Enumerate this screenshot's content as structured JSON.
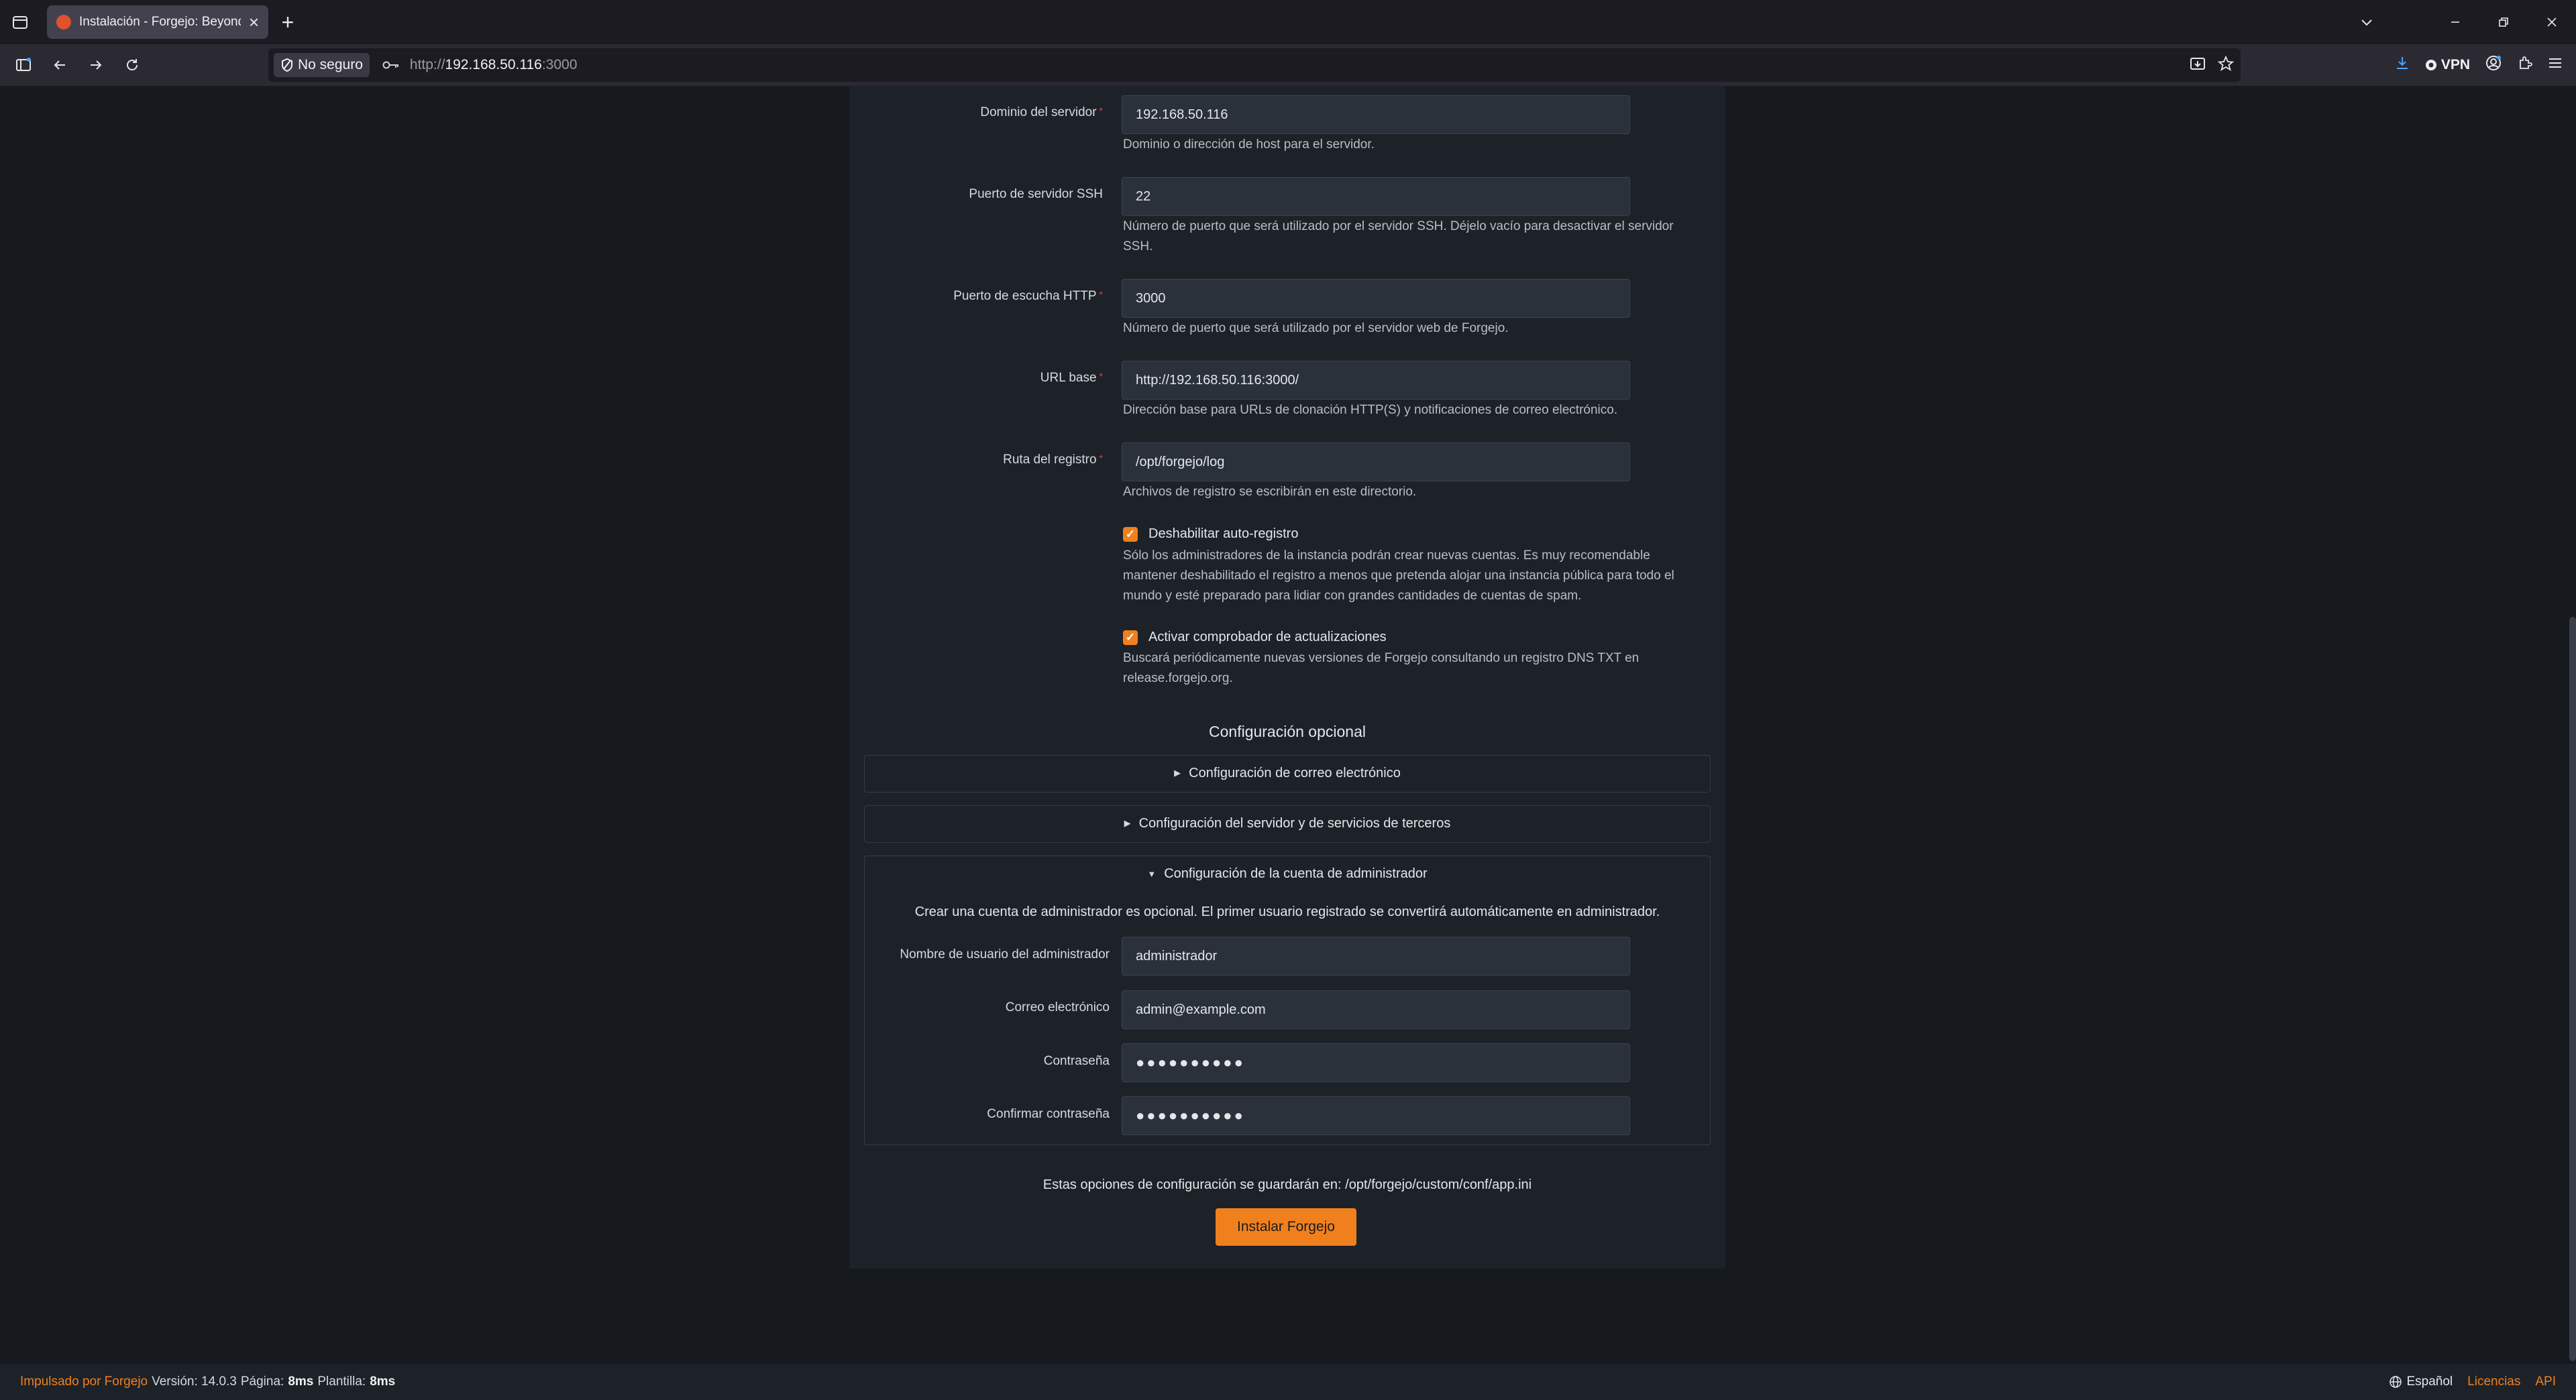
{
  "browser": {
    "tab_title": "Instalación - Forgejo: Beyond co",
    "new_tab": "+",
    "secure_badge": "No seguro",
    "url_prefix": "http://",
    "url_host": "192.168.50.116",
    "url_port": ":3000",
    "vpn_label": "VPN"
  },
  "form": {
    "server_domain": {
      "label": "Dominio del servidor",
      "value": "192.168.50.116",
      "help": "Dominio o dirección de host para el servidor."
    },
    "ssh_port": {
      "label": "Puerto de servidor SSH",
      "value": "22",
      "help": "Número de puerto que será utilizado por el servidor SSH. Déjelo vacío para desactivar el servidor SSH."
    },
    "http_port": {
      "label": "Puerto de escucha HTTP",
      "value": "3000",
      "help": "Número de puerto que será utilizado por el servidor web de Forgejo."
    },
    "base_url": {
      "label": "URL base",
      "value": "http://192.168.50.116:3000/",
      "help": "Dirección base para URLs de clonación HTTP(S) y notificaciones de correo electrónico."
    },
    "log_path": {
      "label": "Ruta del registro",
      "value": "/opt/forgejo/log",
      "help": "Archivos de registro se escribirán en este directorio."
    },
    "disable_registration": {
      "label": "Deshabilitar auto-registro",
      "checked": true,
      "help": "Sólo los administradores de la instancia podrán crear nuevas cuentas. Es muy recomendable mantener deshabilitado el registro a menos que pretenda alojar una instancia pública para todo el mundo y esté preparado para lidiar con grandes cantidades de cuentas de spam."
    },
    "update_checker": {
      "label": "Activar comprobador de actualizaciones",
      "checked": true,
      "help": "Buscará periódicamente nuevas versiones de Forgejo consultando un registro DNS TXT en release.forgejo.org."
    }
  },
  "optional": {
    "title": "Configuración opcional",
    "email_section": "Configuración de correo electrónico",
    "server_section": "Configuración del servidor y de servicios de terceros",
    "admin_section": "Configuración de la cuenta de administrador",
    "admin_note": "Crear una cuenta de administrador es opcional. El primer usuario registrado se convertirá automáticamente en administrador.",
    "admin_username": {
      "label": "Nombre de usuario del administrador",
      "value": "administrador"
    },
    "admin_email": {
      "label": "Correo electrónico",
      "value": "admin@example.com"
    },
    "admin_password": {
      "label": "Contraseña",
      "value": "●●●●●●●●●●"
    },
    "admin_confirm": {
      "label": "Confirmar contraseña",
      "value": "●●●●●●●●●●"
    }
  },
  "save_note": "Estas opciones de configuración se guardarán en: /opt/forgejo/custom/conf/app.ini",
  "install_button": "Instalar Forgejo",
  "footer": {
    "powered": "Impulsado por Forgejo",
    "version": "Versión: 14.0.3",
    "page_label": "Página:",
    "page_time": "8ms",
    "template_label": "Plantilla:",
    "template_time": "8ms",
    "language": "Español",
    "licenses": "Licencias",
    "api": "API"
  },
  "colors": {
    "accent": "#f0801e",
    "required": "#cc4848",
    "background": "#161a1f",
    "card": "#1d2229"
  }
}
